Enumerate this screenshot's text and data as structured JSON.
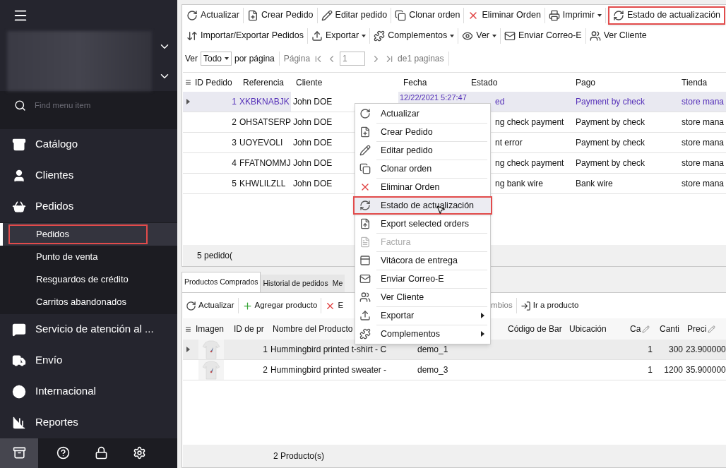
{
  "sidebar": {
    "search_placeholder": "Find menu item",
    "items": [
      {
        "label": "Catálogo",
        "expanded": false
      },
      {
        "label": "Clientes",
        "expanded": false
      },
      {
        "label": "Pedidos",
        "expanded": true,
        "children": [
          {
            "label": "Pedidos",
            "selected": true,
            "highlighted": true
          },
          {
            "label": "Punto de venta",
            "selected": false,
            "highlighted": false
          },
          {
            "label": "Resguardos de crédito",
            "selected": false,
            "highlighted": false
          },
          {
            "label": "Carritos abandonados",
            "selected": false,
            "highlighted": false
          }
        ]
      },
      {
        "label": "Servicio de atención al ...",
        "expanded": false
      },
      {
        "label": "Envío",
        "expanded": false
      },
      {
        "label": "Internacional",
        "expanded": false
      },
      {
        "label": "Reportes",
        "expanded": false
      }
    ],
    "footer_buttons": [
      {
        "selected": true
      },
      {
        "selected": false
      },
      {
        "selected": false
      },
      {
        "selected": false
      }
    ]
  },
  "toolbar_rows": [
    [
      {
        "label": "Actualizar",
        "dropdown": false,
        "highlighted": false
      },
      {
        "label": "Crear Pedido",
        "dropdown": false,
        "highlighted": false
      },
      {
        "label": "Editar pedido",
        "dropdown": false,
        "highlighted": false
      },
      {
        "label": "Clonar orden",
        "dropdown": false,
        "highlighted": false
      },
      {
        "label": "Eliminar Orden",
        "dropdown": false,
        "highlighted": false
      },
      {
        "label": "Imprimir",
        "dropdown": true,
        "highlighted": false
      },
      {
        "label": "Estado de actualización",
        "dropdown": false,
        "highlighted": true
      }
    ],
    [
      {
        "label": "Importar/Exportar Pedidos",
        "dropdown": false,
        "highlighted": false
      },
      {
        "label": "Exportar",
        "dropdown": true,
        "highlighted": false
      },
      {
        "label": "Complementos",
        "dropdown": true,
        "highlighted": false
      },
      {
        "label": "Ver",
        "dropdown": true,
        "highlighted": false
      },
      {
        "label": "Enviar Correo-E",
        "dropdown": false,
        "highlighted": false
      },
      {
        "label": "Ver Cliente",
        "dropdown": false,
        "highlighted": false
      }
    ]
  ],
  "pager": {
    "show_label": "Ver",
    "per_page_value": "Todo",
    "per_page_label": "por página",
    "page_label": "Página",
    "page_value": "1",
    "page_total": "de1 paginas"
  },
  "orders": {
    "columns": [
      "ID Pedido",
      "Referencia",
      "Cliente",
      "Fecha",
      "Estado",
      "Pago",
      "Tienda"
    ],
    "rows": [
      {
        "id": "1",
        "reference": "XKBKNABJK",
        "client": "John DOE",
        "date": "12/22/2021 5:27:47",
        "status": "ed",
        "payment": "Payment by check",
        "store": "store mana",
        "selected": true
      },
      {
        "id": "2",
        "reference": "OHSATSERP",
        "client": "John DOE",
        "status": "ng check payment",
        "payment": "Payment by check",
        "store": "store mana",
        "selected": false
      },
      {
        "id": "3",
        "reference": "UOYEVOLI",
        "client": "John DOE",
        "status": "nt error",
        "payment": "Payment by check",
        "store": "store mana",
        "selected": false
      },
      {
        "id": "4",
        "reference": "FFATNOMMJ",
        "client": "John DOE",
        "status": "ng check payment",
        "payment": "Payment by check",
        "store": "store mana",
        "selected": false
      },
      {
        "id": "5",
        "reference": "KHWLILZLL",
        "client": "John DOE",
        "status": "ng bank wire",
        "payment": "Bank wire",
        "store": "store mana",
        "selected": false
      }
    ],
    "footer": "5 pedido("
  },
  "context_menu": [
    {
      "label": "Actualizar",
      "disabled": false,
      "highlighted": false,
      "submenu": false
    },
    {
      "label": "Crear Pedido",
      "disabled": false,
      "highlighted": false,
      "submenu": false
    },
    {
      "label": "Editar pedido",
      "disabled": false,
      "highlighted": false,
      "submenu": false
    },
    {
      "label": "Clonar orden",
      "disabled": false,
      "highlighted": false,
      "submenu": false
    },
    {
      "label": "Eliminar Orden",
      "disabled": false,
      "highlighted": false,
      "submenu": false
    },
    {
      "label": "Estado de actualización",
      "disabled": false,
      "highlighted": true,
      "submenu": false
    },
    {
      "label": "Export selected orders",
      "disabled": false,
      "highlighted": false,
      "submenu": false
    },
    {
      "label": "Factura",
      "disabled": true,
      "highlighted": false,
      "submenu": false
    },
    {
      "label": "Vitácora de entrega",
      "disabled": false,
      "highlighted": false,
      "submenu": false
    },
    {
      "label": "Enviar Correo-E",
      "disabled": false,
      "highlighted": false,
      "submenu": false
    },
    {
      "label": "Ver Cliente",
      "disabled": false,
      "highlighted": false,
      "submenu": false
    },
    {
      "label": "Exportar",
      "disabled": false,
      "highlighted": false,
      "submenu": true
    },
    {
      "label": "Complementos",
      "disabled": false,
      "highlighted": false,
      "submenu": true
    }
  ],
  "detail_tabs": [
    {
      "label": "Productos Comprados",
      "selected": true
    },
    {
      "label": "Historial de pedidos",
      "selected": false
    },
    {
      "label": "Me",
      "selected": false
    }
  ],
  "detail_toolbar": [
    {
      "label": "Actualizar",
      "disabled": false
    },
    {
      "label": "Agregar producto",
      "disabled": false
    },
    {
      "label": "E",
      "disabled": false
    },
    {
      "label": "mbios",
      "disabled": true
    },
    {
      "label": "Ir a producto",
      "disabled": false
    }
  ],
  "products": {
    "columns": [
      "Imagen",
      "ID de pr",
      "Nombre del Producto",
      "Código de Bar",
      "Ubicación",
      "Ca",
      "Canti",
      "Preci"
    ],
    "rows": [
      {
        "id": "1",
        "name": "Hummingbird printed t-shirt - C",
        "reference": "demo_1",
        "col_6": "1",
        "quantity": "300",
        "price": "23.900000",
        "selected": true
      },
      {
        "id": "2",
        "name": "Hummingbird printed sweater - ",
        "reference": "demo_3",
        "col_6": "1",
        "quantity": "1200",
        "price": "35.900000",
        "selected": false
      }
    ],
    "footer": "2 Producto(s)"
  }
}
